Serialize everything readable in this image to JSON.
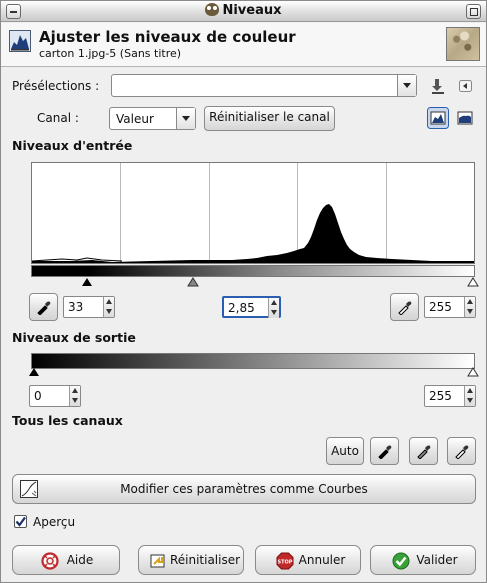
{
  "window": {
    "title": "Niveaux"
  },
  "header": {
    "title": "Ajuster les niveaux de couleur",
    "subtitle": "carton 1.jpg-5 (Sans titre)",
    "icon": "levels-icon"
  },
  "presets": {
    "label": "Présélections :",
    "value": ""
  },
  "channel": {
    "label": "Canal :",
    "value": "Valeur",
    "reset_label": "Réinitialiser le canal",
    "linear_histogram_icon": "linear-histogram-icon",
    "log_histogram_icon": "logarithmic-histogram-icon"
  },
  "input_levels": {
    "title": "Niveaux d'entrée",
    "low": "33",
    "gamma": "2,85",
    "high": "255"
  },
  "output_levels": {
    "title": "Niveaux de sortie",
    "low": "0",
    "high": "255"
  },
  "all_channels": {
    "title": "Tous les canaux",
    "auto_label": "Auto"
  },
  "curves_button": {
    "label": "Modifier ces paramètres comme Courbes"
  },
  "preview": {
    "label": "Aperçu",
    "checked": true
  },
  "buttons": {
    "help": "Aide",
    "reset": "Réinitialiser",
    "cancel": "Annuler",
    "ok": "Valider"
  },
  "colors": {
    "accent": "#2a5fb0",
    "ok_green": "#3aa13a",
    "cancel_red": "#c0282a"
  }
}
